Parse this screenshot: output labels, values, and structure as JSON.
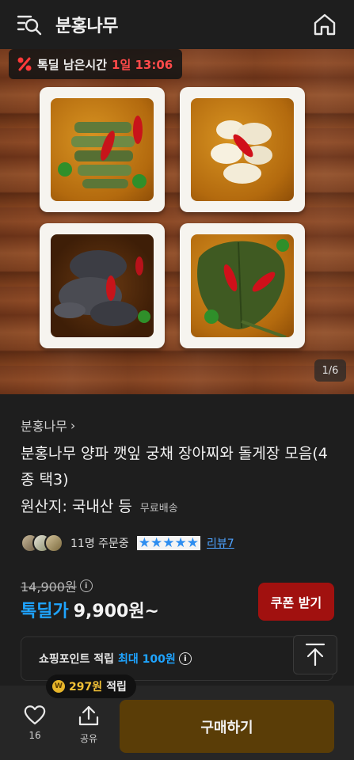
{
  "header": {
    "title": "분홍나무",
    "menu_icon": "menu-search-icon",
    "home_icon": "home-icon"
  },
  "hero": {
    "deal_timer_label": "톡딜 남은시간",
    "deal_timer_value": "1일 13:06",
    "pager": "1/6"
  },
  "product": {
    "brand": "분홍나무",
    "name": "분홍나무 양파 깻잎 궁채 장아찌와 돌게장 모음(4종 택3)",
    "origin": "원산지: 국내산 등",
    "shipping": "무료배송",
    "orders": "11명 주문중",
    "review_link": "리뷰7",
    "rating_fraction": 1.0,
    "original_price": "14,900원",
    "deal_label": "톡딜가",
    "deal_price": "9,900원~",
    "coupon_button": "쿠폰 받기"
  },
  "points": {
    "label": "쇼핑포인트 적립",
    "max": "최대 100원",
    "pill_amount": "297원",
    "pill_suffix": "적립"
  },
  "bottom_bar": {
    "like_count": "16",
    "share_label": "공유",
    "buy_button": "구매하기"
  },
  "colors": {
    "accent_blue": "#1fa4ff",
    "deal_red": "#ff4a4a",
    "coupon_bg": "#a1110f",
    "buy_bg": "#5a3d07",
    "background": "#1e1e1e"
  }
}
